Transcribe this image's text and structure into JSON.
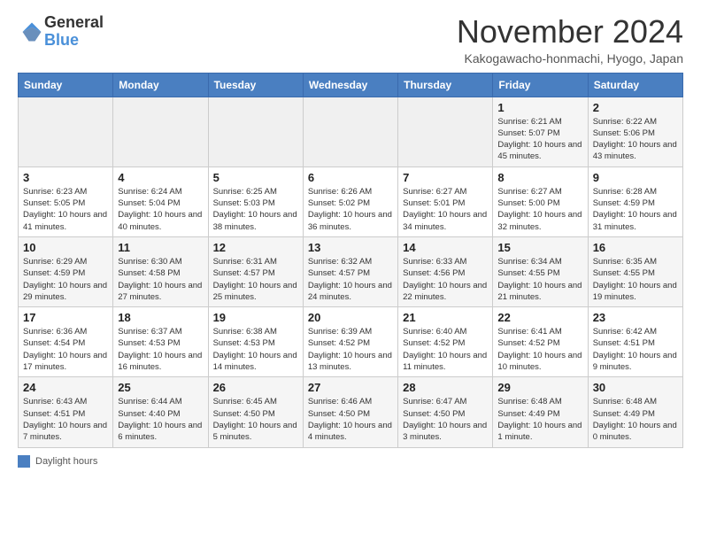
{
  "header": {
    "logo_general": "General",
    "logo_blue": "Blue",
    "month_title": "November 2024",
    "location": "Kakogawacho-honmachi, Hyogo, Japan"
  },
  "columns": [
    "Sunday",
    "Monday",
    "Tuesday",
    "Wednesday",
    "Thursday",
    "Friday",
    "Saturday"
  ],
  "weeks": [
    [
      {
        "day": "",
        "info": ""
      },
      {
        "day": "",
        "info": ""
      },
      {
        "day": "",
        "info": ""
      },
      {
        "day": "",
        "info": ""
      },
      {
        "day": "",
        "info": ""
      },
      {
        "day": "1",
        "info": "Sunrise: 6:21 AM\nSunset: 5:07 PM\nDaylight: 10 hours and 45 minutes."
      },
      {
        "day": "2",
        "info": "Sunrise: 6:22 AM\nSunset: 5:06 PM\nDaylight: 10 hours and 43 minutes."
      }
    ],
    [
      {
        "day": "3",
        "info": "Sunrise: 6:23 AM\nSunset: 5:05 PM\nDaylight: 10 hours and 41 minutes."
      },
      {
        "day": "4",
        "info": "Sunrise: 6:24 AM\nSunset: 5:04 PM\nDaylight: 10 hours and 40 minutes."
      },
      {
        "day": "5",
        "info": "Sunrise: 6:25 AM\nSunset: 5:03 PM\nDaylight: 10 hours and 38 minutes."
      },
      {
        "day": "6",
        "info": "Sunrise: 6:26 AM\nSunset: 5:02 PM\nDaylight: 10 hours and 36 minutes."
      },
      {
        "day": "7",
        "info": "Sunrise: 6:27 AM\nSunset: 5:01 PM\nDaylight: 10 hours and 34 minutes."
      },
      {
        "day": "8",
        "info": "Sunrise: 6:27 AM\nSunset: 5:00 PM\nDaylight: 10 hours and 32 minutes."
      },
      {
        "day": "9",
        "info": "Sunrise: 6:28 AM\nSunset: 4:59 PM\nDaylight: 10 hours and 31 minutes."
      }
    ],
    [
      {
        "day": "10",
        "info": "Sunrise: 6:29 AM\nSunset: 4:59 PM\nDaylight: 10 hours and 29 minutes."
      },
      {
        "day": "11",
        "info": "Sunrise: 6:30 AM\nSunset: 4:58 PM\nDaylight: 10 hours and 27 minutes."
      },
      {
        "day": "12",
        "info": "Sunrise: 6:31 AM\nSunset: 4:57 PM\nDaylight: 10 hours and 25 minutes."
      },
      {
        "day": "13",
        "info": "Sunrise: 6:32 AM\nSunset: 4:57 PM\nDaylight: 10 hours and 24 minutes."
      },
      {
        "day": "14",
        "info": "Sunrise: 6:33 AM\nSunset: 4:56 PM\nDaylight: 10 hours and 22 minutes."
      },
      {
        "day": "15",
        "info": "Sunrise: 6:34 AM\nSunset: 4:55 PM\nDaylight: 10 hours and 21 minutes."
      },
      {
        "day": "16",
        "info": "Sunrise: 6:35 AM\nSunset: 4:55 PM\nDaylight: 10 hours and 19 minutes."
      }
    ],
    [
      {
        "day": "17",
        "info": "Sunrise: 6:36 AM\nSunset: 4:54 PM\nDaylight: 10 hours and 17 minutes."
      },
      {
        "day": "18",
        "info": "Sunrise: 6:37 AM\nSunset: 4:53 PM\nDaylight: 10 hours and 16 minutes."
      },
      {
        "day": "19",
        "info": "Sunrise: 6:38 AM\nSunset: 4:53 PM\nDaylight: 10 hours and 14 minutes."
      },
      {
        "day": "20",
        "info": "Sunrise: 6:39 AM\nSunset: 4:52 PM\nDaylight: 10 hours and 13 minutes."
      },
      {
        "day": "21",
        "info": "Sunrise: 6:40 AM\nSunset: 4:52 PM\nDaylight: 10 hours and 11 minutes."
      },
      {
        "day": "22",
        "info": "Sunrise: 6:41 AM\nSunset: 4:52 PM\nDaylight: 10 hours and 10 minutes."
      },
      {
        "day": "23",
        "info": "Sunrise: 6:42 AM\nSunset: 4:51 PM\nDaylight: 10 hours and 9 minutes."
      }
    ],
    [
      {
        "day": "24",
        "info": "Sunrise: 6:43 AM\nSunset: 4:51 PM\nDaylight: 10 hours and 7 minutes."
      },
      {
        "day": "25",
        "info": "Sunrise: 6:44 AM\nSunset: 4:40 PM\nDaylight: 10 hours and 6 minutes."
      },
      {
        "day": "26",
        "info": "Sunrise: 6:45 AM\nSunset: 4:50 PM\nDaylight: 10 hours and 5 minutes."
      },
      {
        "day": "27",
        "info": "Sunrise: 6:46 AM\nSunset: 4:50 PM\nDaylight: 10 hours and 4 minutes."
      },
      {
        "day": "28",
        "info": "Sunrise: 6:47 AM\nSunset: 4:50 PM\nDaylight: 10 hours and 3 minutes."
      },
      {
        "day": "29",
        "info": "Sunrise: 6:48 AM\nSunset: 4:49 PM\nDaylight: 10 hours and 1 minute."
      },
      {
        "day": "30",
        "info": "Sunrise: 6:48 AM\nSunset: 4:49 PM\nDaylight: 10 hours and 0 minutes."
      }
    ]
  ],
  "footer": {
    "legend_label": "Daylight hours"
  }
}
